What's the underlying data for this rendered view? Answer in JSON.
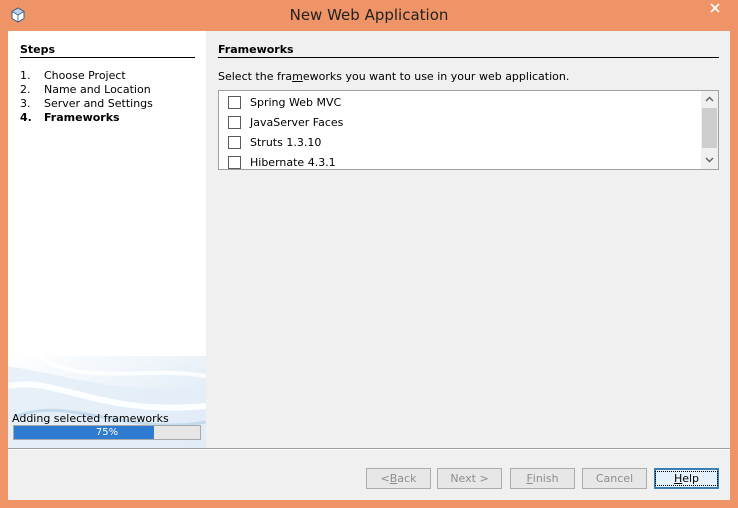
{
  "window": {
    "title": "New Web Application",
    "close_icon": "close-icon"
  },
  "steps": {
    "title": "Steps",
    "items": [
      {
        "num": "1.",
        "label": "Choose Project"
      },
      {
        "num": "2.",
        "label": "Name and Location"
      },
      {
        "num": "3.",
        "label": "Server and Settings"
      },
      {
        "num": "4.",
        "label": "Frameworks"
      }
    ],
    "current_index": 3
  },
  "progress": {
    "label": "Adding selected frameworks",
    "text": "75%",
    "fraction": 0.75
  },
  "frameworks": {
    "title": "Frameworks",
    "instructions_pre": "Select the fra",
    "instructions_mnemonic": "m",
    "instructions_post": "eworks you want to use in your web application.",
    "items": [
      {
        "label": "Spring Web MVC",
        "checked": false
      },
      {
        "label": "JavaServer Faces",
        "checked": false
      },
      {
        "label": "Struts 1.3.10",
        "checked": false
      },
      {
        "label": "Hibernate 4.3.1",
        "checked": false
      }
    ]
  },
  "buttons": {
    "back_pre": "< ",
    "back_mnemonic": "B",
    "back_post": "ack",
    "next": "Next >",
    "finish_mnemonic": "F",
    "finish_post": "inish",
    "cancel": "Cancel",
    "help_mnemonic": "H",
    "help_post": "elp"
  },
  "colors": {
    "window_frame": "#ee9466",
    "progress_fill": "#2e7bd1",
    "default_button_border": "#3c7fb1"
  }
}
